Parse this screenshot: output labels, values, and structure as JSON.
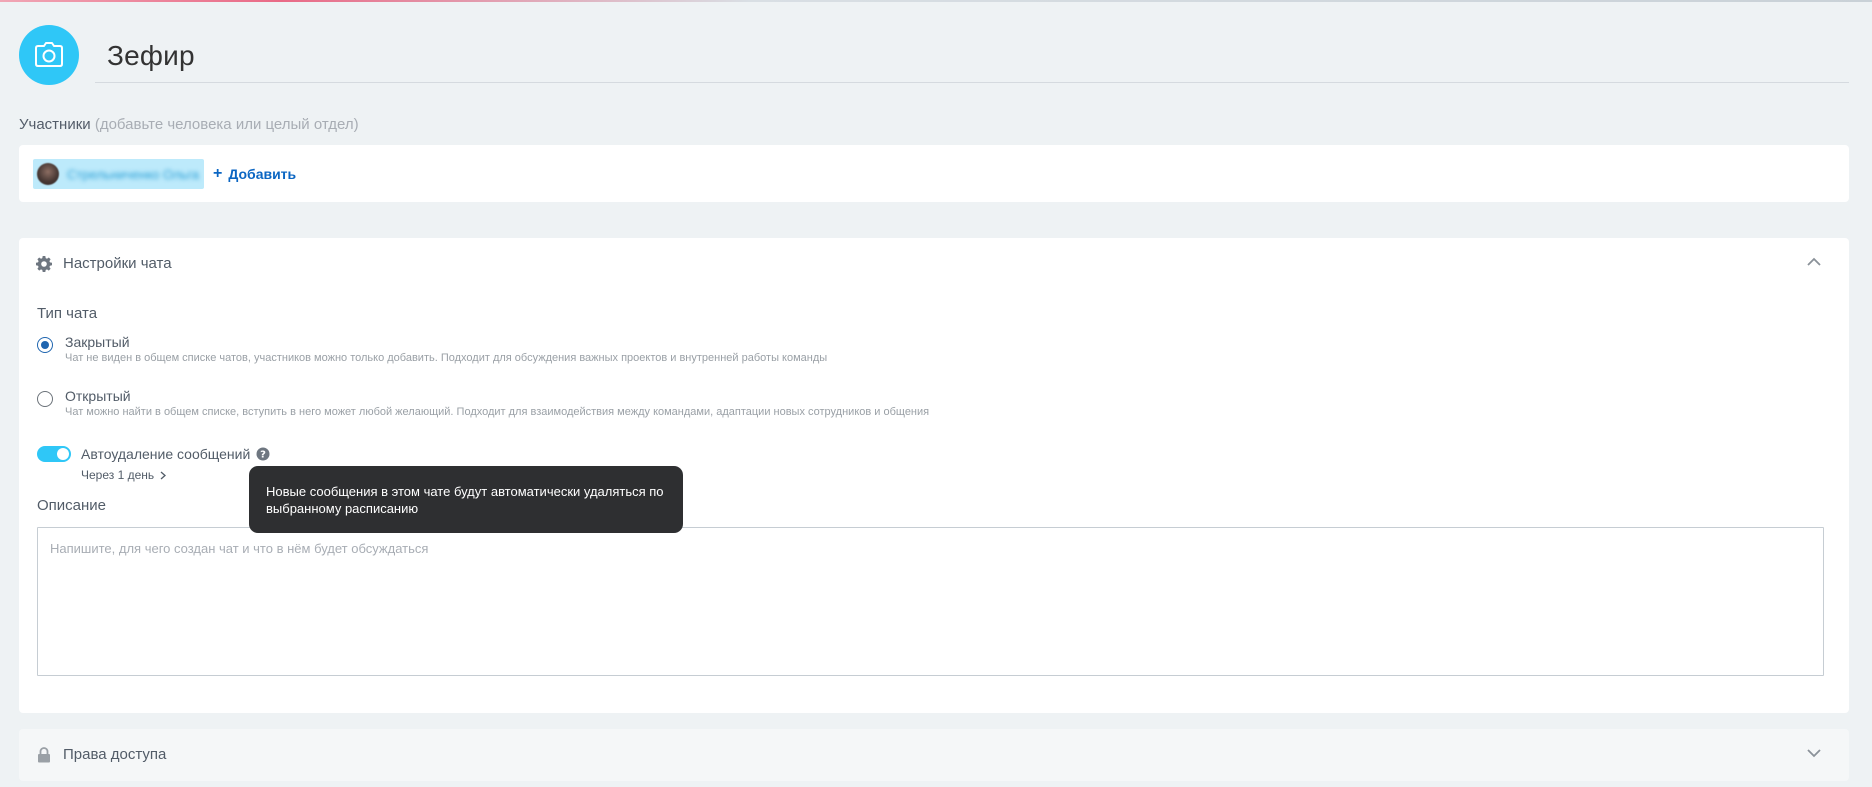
{
  "header": {
    "title": "Зефир",
    "avatar_icon": "camera-icon"
  },
  "participants": {
    "label": "Участники",
    "hint": "(добавьте человека или целый отдел)",
    "members": [
      {
        "name": "Стрельниченко Ольга"
      }
    ],
    "add_label": "Добавить"
  },
  "settings": {
    "title": "Настройки чата",
    "icon": "gear-icon",
    "chat_type_label": "Тип чата",
    "options": [
      {
        "title": "Закрытый",
        "description": "Чат не виден в общем списке чатов, участников можно только добавить. Подходит для обсуждения важных проектов и внутренней работы команды",
        "checked": true
      },
      {
        "title": "Открытый",
        "description": "Чат можно найти в общем списке, вступить в него может любой желающий. Подходит для взаимодействия между командами, адаптации новых сотрудников и общения",
        "checked": false
      }
    ],
    "autodelete": {
      "label": "Автоудаление сообщений",
      "enabled": true,
      "period": "Через 1 день"
    },
    "description_label": "Описание",
    "description_placeholder": "Напишите, для чего создан чат и что в нём будет обсуждаться",
    "description_value": ""
  },
  "access": {
    "title": "Права доступа",
    "icon": "lock-icon"
  },
  "tooltip": {
    "text": "Новые сообщения в этом чате будут автоматически удаляться по выбранному расписанию"
  },
  "colors": {
    "accent": "#2fc7f7",
    "link": "#0b66c3",
    "background": "#eef2f4"
  }
}
